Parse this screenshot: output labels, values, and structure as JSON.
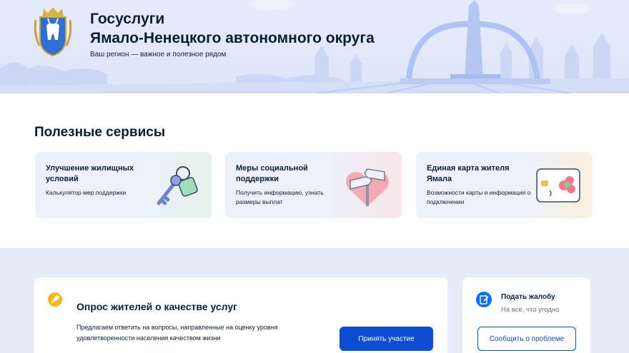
{
  "hero": {
    "title_line1": "Госуслуги",
    "title_line2": "Ямало-Ненецкого автономного округа",
    "subtitle": "Ваш регион — важное и полезное рядом",
    "emblem_icon": "yanao-coat-of-arms-icon",
    "colors": {
      "background": "#e3eafb",
      "illustration": "#a9bff0"
    }
  },
  "services": {
    "heading": "Полезные сервисы",
    "cards": [
      {
        "title": "Улучшение жилищных условий",
        "desc": "Калькулятор мер поддержки",
        "icon": "keys-icon"
      },
      {
        "title": "Меры социальной поддержки",
        "desc": "Получить информацию, узнать размеры выплат",
        "icon": "signpost-heart-icon"
      },
      {
        "title": "Единая карта жителя Ямала",
        "desc": "Возможности карты и информация о подключении",
        "icon": "resident-card-icon"
      }
    ]
  },
  "poll": {
    "title": "Опрос жителей о качестве услуг",
    "desc": "Предлагаем ответить на вопросы, направленные на оценку уровня удовлетворенности населения качеством жизни",
    "button": "Принять участие",
    "icon": "rocket-icon"
  },
  "complaint": {
    "title": "Подать жалобу",
    "subtitle": "На всё, что угодно",
    "button": "Сообщить о проблеме",
    "icon": "complaint-edit-icon"
  },
  "colors": {
    "primary": "#0d4cd3",
    "text": "#0b1f33",
    "muted": "#66727f",
    "accent_yellow": "#f5b720"
  }
}
